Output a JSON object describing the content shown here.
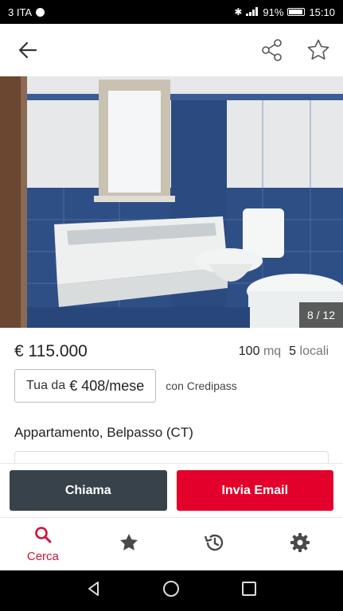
{
  "status_bar": {
    "carrier": "3 ITA",
    "battery": "91%",
    "time": "15:10"
  },
  "app_bar": {
    "back_icon": "arrow-left-icon",
    "share_icon": "share-icon",
    "favorite_icon": "star-outline-icon"
  },
  "gallery": {
    "counter": "8 / 12"
  },
  "listing": {
    "price": "€ 115.000",
    "surface_value": "100",
    "surface_unit": "mq",
    "rooms_value": "5",
    "rooms_unit": "locali",
    "credit_prefix": "Tua da",
    "credit_amount": "€ 408/mese",
    "credit_provider": "con Credipass",
    "title": "Appartamento, Belpasso (CT)"
  },
  "actions": {
    "call_label": "Chiama",
    "email_label": "Invia Email"
  },
  "bottom_nav": {
    "items": [
      {
        "label": "Cerca",
        "icon": "search-icon",
        "active": true
      },
      {
        "label": "",
        "icon": "star-icon"
      },
      {
        "label": "",
        "icon": "history-icon"
      },
      {
        "label": "",
        "icon": "settings-icon"
      }
    ]
  },
  "colors": {
    "accent": "#e3002b",
    "dark_button": "#38424b",
    "nav_active": "#d0123a"
  }
}
